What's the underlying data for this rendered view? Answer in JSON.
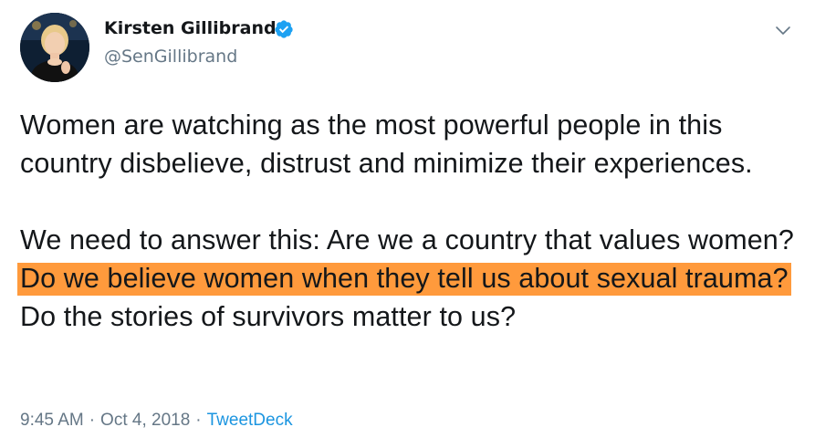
{
  "author": {
    "name": "Kirsten Gillibrand",
    "handle": "@SenGillibrand",
    "verified": true,
    "avatar_icon": "profile-photo"
  },
  "tweet": {
    "paragraph1": "Women are watching as the most powerful people in this country disbelieve, distrust and minimize their experiences.",
    "paragraph2_before": "We need to answer this: Are we a country that values women? ",
    "paragraph2_highlight": "Do we believe women when they tell us about sexual trauma?",
    "paragraph2_after": " Do the stories of survivors matter to us?"
  },
  "meta": {
    "time": "9:45 AM",
    "separator": "·",
    "date": "Oct 4, 2018",
    "source": "TweetDeck"
  },
  "colors": {
    "highlight": "#ff9a3c",
    "verified_badge": "#1da1f2",
    "link": "#1b95e0",
    "muted": "#657786"
  }
}
